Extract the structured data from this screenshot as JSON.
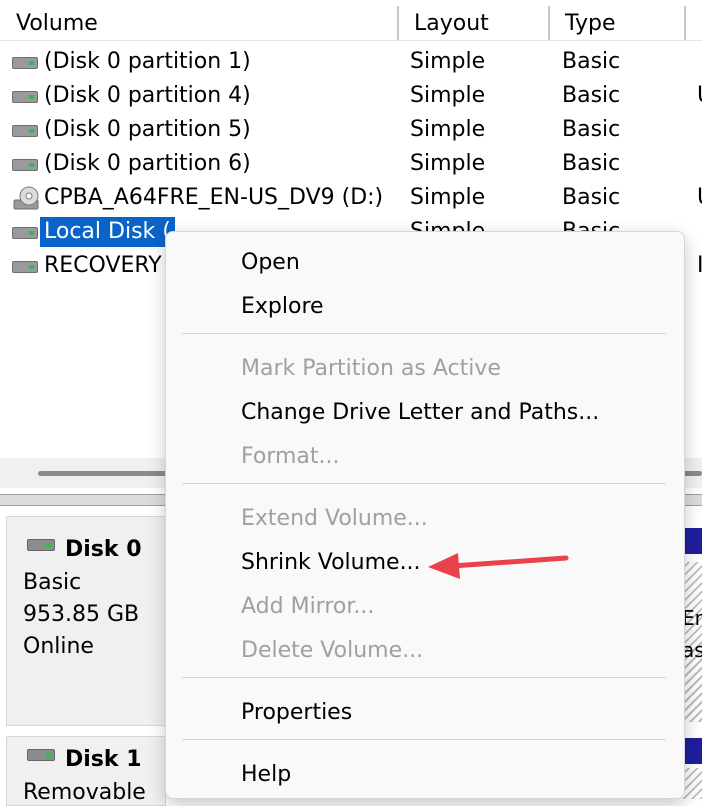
{
  "columns": {
    "volume": "Volume",
    "layout": "Layout",
    "type": "Type"
  },
  "volumes": [
    {
      "name": "(Disk 0 partition 1)",
      "layout": "Simple",
      "type": "Basic",
      "extra": ""
    },
    {
      "name": "(Disk 0 partition 4)",
      "layout": "Simple",
      "type": "Basic",
      "extra": "U"
    },
    {
      "name": "(Disk 0 partition 5)",
      "layout": "Simple",
      "type": "Basic",
      "extra": ""
    },
    {
      "name": "(Disk 0 partition 6)",
      "layout": "Simple",
      "type": "Basic",
      "extra": ""
    },
    {
      "name": "CPBA_A64FRE_EN-US_DV9 (D:)",
      "layout": "Simple",
      "type": "Basic",
      "extra": "U"
    },
    {
      "name": "Local Disk (",
      "layout": "Simple",
      "type": "Basic",
      "extra": ""
    },
    {
      "name": "RECOVERY",
      "layout": "",
      "type": "",
      "extra": "I"
    }
  ],
  "disks": [
    {
      "name": "Disk 0",
      "lines": [
        "Basic",
        "953.85 GB",
        "Online"
      ]
    },
    {
      "name": "Disk 1",
      "lines": [
        "Removable"
      ]
    }
  ],
  "partition_fragments": [
    "En",
    "as"
  ],
  "context_menu": {
    "items": [
      {
        "label": "Open",
        "enabled": true
      },
      {
        "label": "Explore",
        "enabled": true
      },
      {
        "label": "Mark Partition as Active",
        "enabled": false
      },
      {
        "label": "Change Drive Letter and Paths...",
        "enabled": true
      },
      {
        "label": "Format...",
        "enabled": false
      },
      {
        "label": "Extend Volume...",
        "enabled": false
      },
      {
        "label": "Shrink Volume...",
        "enabled": true
      },
      {
        "label": "Add Mirror...",
        "enabled": false
      },
      {
        "label": "Delete Volume...",
        "enabled": false
      },
      {
        "label": "Properties",
        "enabled": true
      },
      {
        "label": "Help",
        "enabled": true
      }
    ]
  },
  "colors": {
    "selection": "#0a64c8",
    "arrow": "#e8434a",
    "partition_bar": "#1e1ea0"
  },
  "icons": {
    "drive": "hard-drive-icon",
    "optical": "optical-disc-icon",
    "disk": "disk-icon"
  }
}
